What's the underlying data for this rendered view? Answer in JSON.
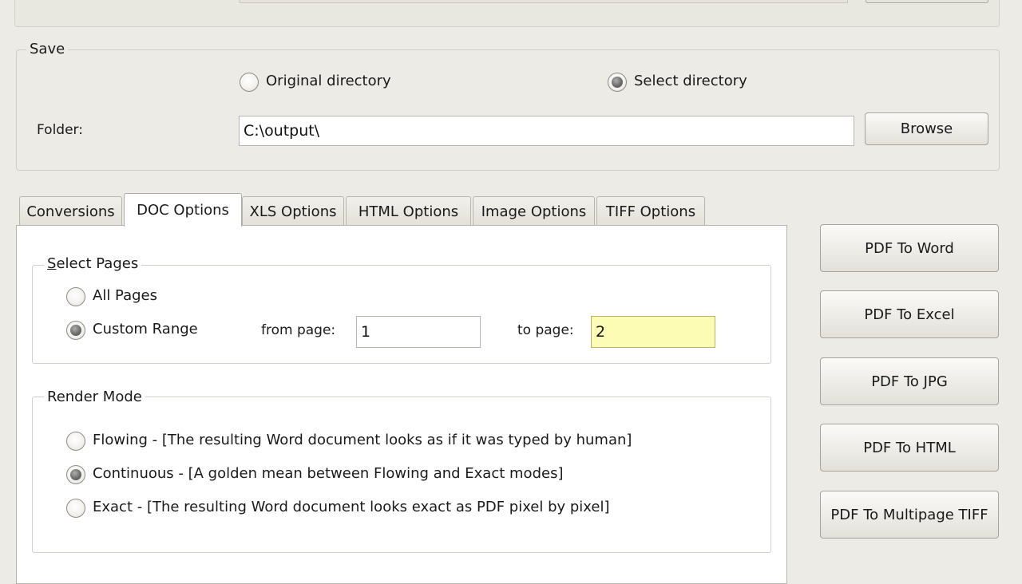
{
  "save_group": {
    "title": "Save",
    "original_directory_label": "Original directory",
    "select_directory_label": "Select directory",
    "selected": "select_directory",
    "folder_label": "Folder:",
    "folder_value": "C:\\output\\",
    "browse_label": "Browse"
  },
  "tabs": [
    {
      "label": "Conversions",
      "active": false
    },
    {
      "label": "DOC Options",
      "active": true
    },
    {
      "label": "XLS Options",
      "active": false
    },
    {
      "label": "HTML Options",
      "active": false
    },
    {
      "label": "Image Options",
      "active": false
    },
    {
      "label": "TIFF Options",
      "active": false
    }
  ],
  "select_pages": {
    "title": "Select Pages",
    "all_pages_label": "All Pages",
    "custom_range_label": "Custom Range",
    "selected": "custom_range",
    "from_page_label": "from page:",
    "from_page_value": "1",
    "to_page_label": "to page:",
    "to_page_value": "2"
  },
  "render_mode": {
    "title": "Render Mode",
    "selected": "continuous",
    "options": [
      {
        "label": "Flowing - [The resulting Word document looks as if it was typed by human]"
      },
      {
        "label": "Continuous - [A golden mean between Flowing and Exact modes]"
      },
      {
        "label": "Exact - [The resulting Word document looks exact as PDF pixel by pixel]"
      }
    ]
  },
  "actions": {
    "pdf_to_word": "PDF To Word",
    "pdf_to_excel": "PDF To Excel",
    "pdf_to_jpg": "PDF To JPG",
    "pdf_to_html": "PDF To HTML",
    "pdf_to_tiff": "PDF To Multipage TIFF"
  },
  "colors": {
    "window_bg": "#ecebe5",
    "highlight_field": "#fcfcb4"
  }
}
